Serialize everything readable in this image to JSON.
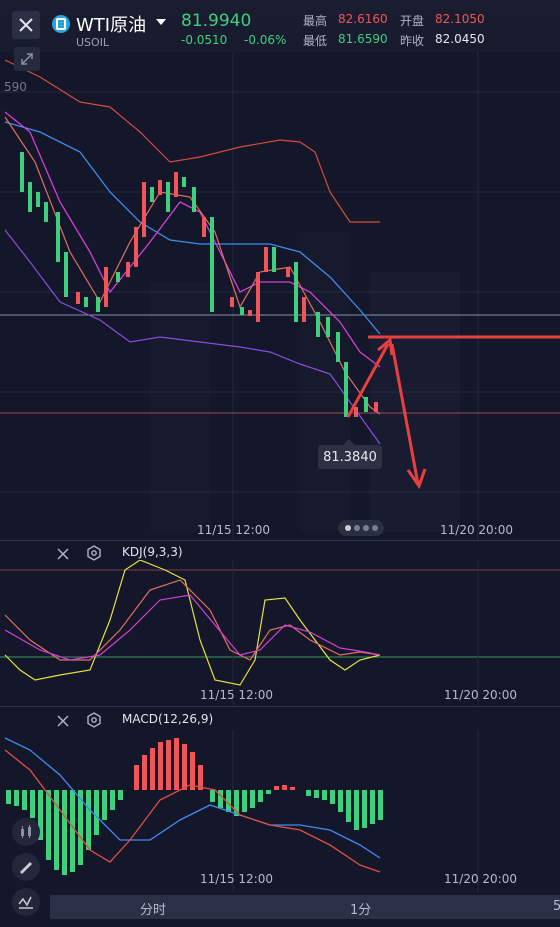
{
  "header": {
    "title": "WTI原油",
    "symbol": "USOIL",
    "price": "81.9940",
    "change": "-0.0510",
    "change_pct": "-0.06%",
    "stats": [
      {
        "label": "最高",
        "value": "82.6160",
        "color": "#f0555a"
      },
      {
        "label": "开盘",
        "value": "82.1050",
        "color": "#f0555a"
      },
      {
        "label": "最低",
        "value": "81.6590",
        "color": "#3ecf7f"
      },
      {
        "label": "昨收",
        "value": "82.0450",
        "color": "#e6e8ef"
      }
    ]
  },
  "main_chart": {
    "price_axis_partial": "590",
    "x_labels": [
      "11/15 12:00",
      "11/20 20:00"
    ],
    "last_price_tag": "81.3840"
  },
  "kdj": {
    "label": "KDJ(9,3,3)",
    "x_labels": [
      "11/15 12:00",
      "11/20 20:00"
    ]
  },
  "macd": {
    "label": "MACD(12,26,9)",
    "x_labels": [
      "11/15 12:00",
      "11/20 20:00"
    ]
  },
  "tabs": [
    "分时",
    "1分",
    "5"
  ],
  "icons": {
    "close": "close-icon",
    "expand": "expand-icon",
    "settings": "settings-icon",
    "candle": "candle-chart-icon",
    "draw": "pencil-icon",
    "indicator": "indicator-icon"
  },
  "colors": {
    "up": "#f0555a",
    "down": "#3ecf7f",
    "background": "#14172a"
  }
}
